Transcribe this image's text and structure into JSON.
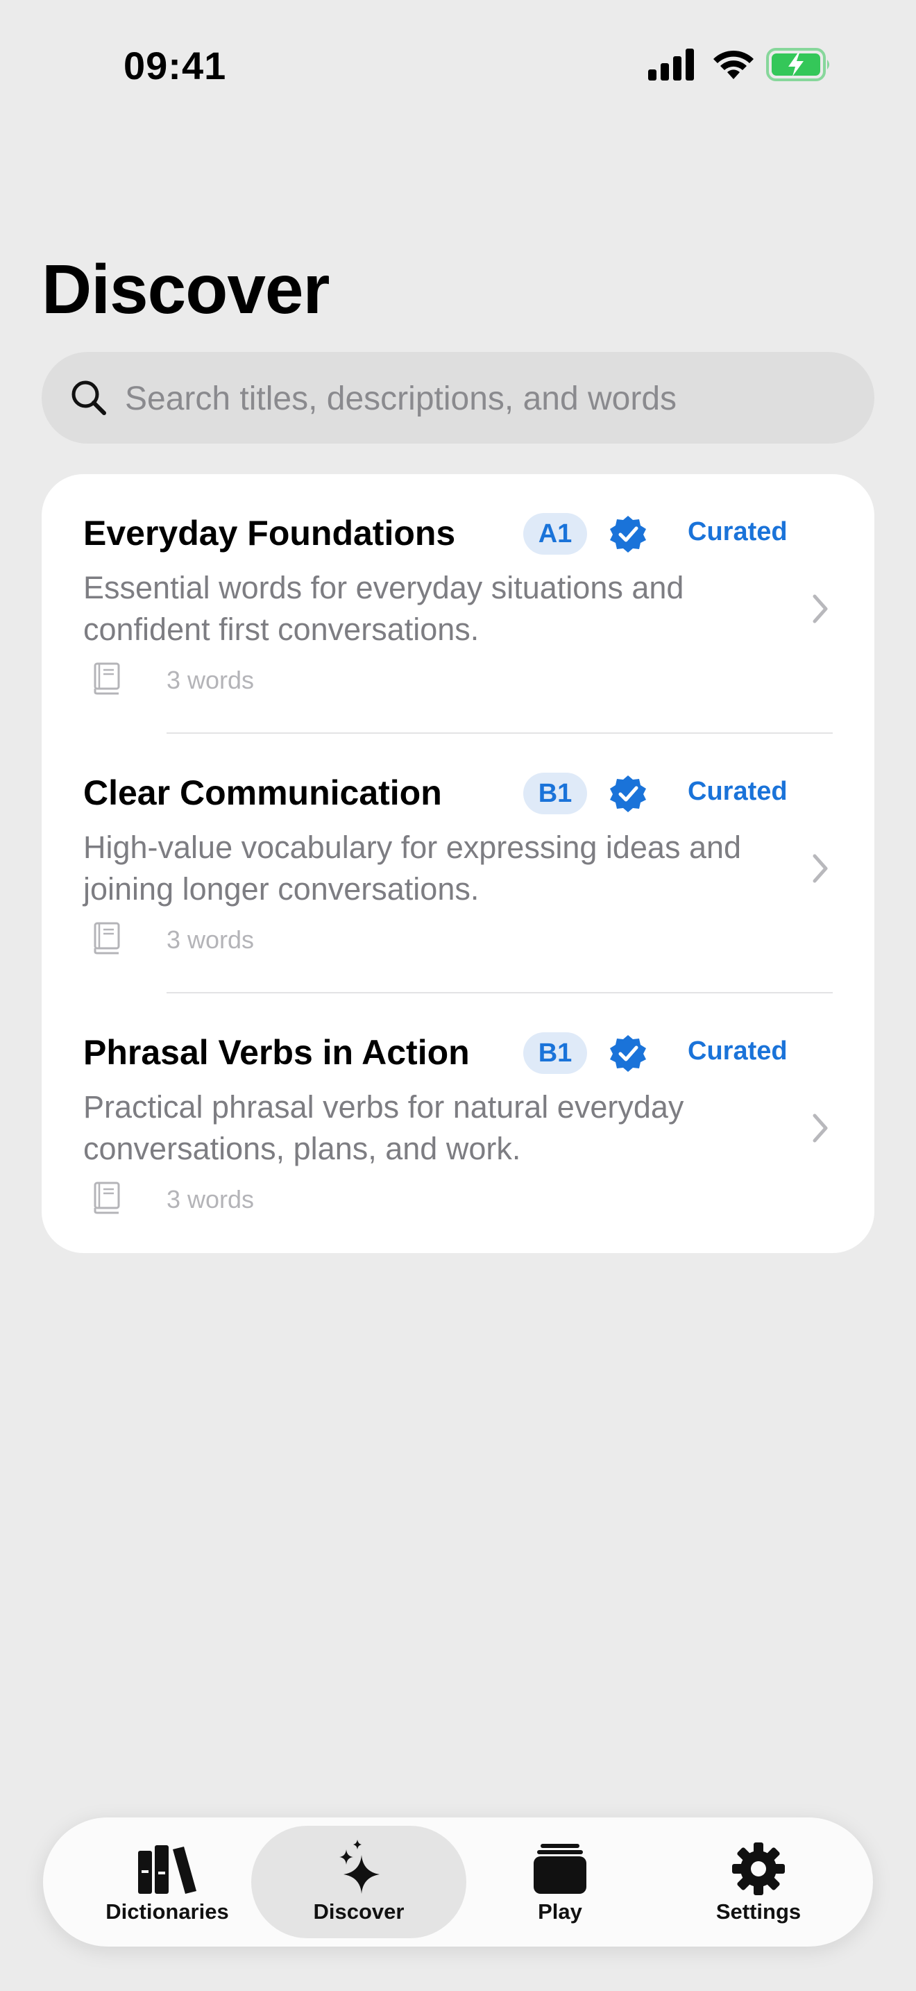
{
  "status_bar": {
    "time": "09:41",
    "icons": [
      "cellular-signal-icon",
      "wifi-icon",
      "battery-charging-icon"
    ],
    "battery_color": "#34c759"
  },
  "header": {
    "title": "Discover"
  },
  "search": {
    "placeholder": "Search titles, descriptions, and words",
    "value": "",
    "icon": "magnifying-glass-icon"
  },
  "collections": [
    {
      "title": "Everyday Foundations",
      "level": "A1",
      "curated_label": "Curated",
      "description": "Essential words for everyday situations and confident first conversations.",
      "word_count": "3 words"
    },
    {
      "title": "Clear Communication",
      "level": "B1",
      "curated_label": "Curated",
      "description": "High-value vocabulary for expressing ideas and joining longer conversations.",
      "word_count": "3 words"
    },
    {
      "title": "Phrasal Verbs in Action",
      "level": "B1",
      "curated_label": "Curated",
      "description": "Practical phrasal verbs for natural everyday conversations, plans, and work.",
      "word_count": "3 words"
    }
  ],
  "tab_bar": {
    "tabs": [
      {
        "label": "Dictionaries",
        "icon": "books-icon",
        "active": false
      },
      {
        "label": "Discover",
        "icon": "sparkles-icon",
        "active": true
      },
      {
        "label": "Play",
        "icon": "cards-stack-icon",
        "active": false
      },
      {
        "label": "Settings",
        "icon": "gear-icon",
        "active": false
      }
    ]
  },
  "colors": {
    "accent": "#1a73d9",
    "background": "#ebebeb",
    "card": "#ffffff",
    "badge_background": "#dfeaf8"
  }
}
